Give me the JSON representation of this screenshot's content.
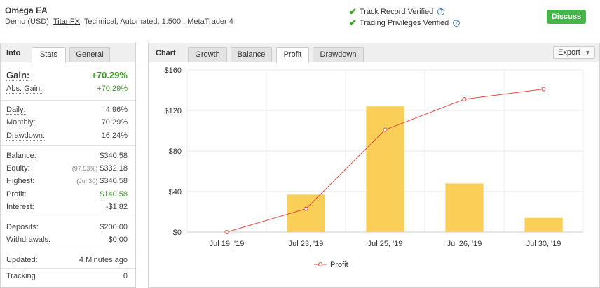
{
  "header": {
    "title": "Omega EA",
    "sub_prefix": "Demo (USD), ",
    "broker_link": "TitanFX",
    "sub_suffix": ", Technical, Automated, 1:500 , MetaTrader 4",
    "verify1": "Track Record Verified",
    "verify2": "Trading Privileges Verified",
    "help_glyph": "?",
    "discuss": "Discuss"
  },
  "info": {
    "tab_title": "Info",
    "tabs": [
      "Stats",
      "General"
    ],
    "gain_label": "Gain:",
    "gain_value": "+70.29%",
    "rows": [
      {
        "k": "Abs. Gain:",
        "v": "+70.29%"
      },
      {
        "k": "Daily:",
        "v": "4.96%"
      },
      {
        "k": "Monthly:",
        "v": "70.29%"
      },
      {
        "k": "Drawdown:",
        "v": "16.24%"
      },
      {
        "k": "Balance:",
        "v": "$340.58"
      },
      {
        "k": "Equity:",
        "pre": "(97.53%)",
        "v": "$332.18"
      },
      {
        "k": "Highest:",
        "pre": "(Jul 30)",
        "v": "$340.58"
      },
      {
        "k": "Profit:",
        "v": "$140.58"
      },
      {
        "k": "Interest:",
        "v": "-$1.82"
      },
      {
        "k": "Deposits:",
        "v": "$200.00"
      },
      {
        "k": "Withdrawals:",
        "v": "$0.00"
      },
      {
        "k": "Updated:",
        "v": "4 Minutes ago"
      },
      {
        "k": "Tracking",
        "v": "0"
      }
    ]
  },
  "chart_panel": {
    "title": "Chart",
    "tabs": [
      "Growth",
      "Balance",
      "Profit",
      "Drawdown"
    ],
    "active_tab": "Profit",
    "export": "Export",
    "caret": "▼"
  },
  "colors": {
    "bar": "#f9cf57",
    "line": "#e34a3d",
    "green": "#45b549"
  },
  "chart_data": {
    "type": "bar",
    "categories": [
      "Jul 19, '19",
      "Jul 23, '19",
      "Jul 25, '19",
      "Jul 26, '19",
      "Jul 30, '19"
    ],
    "series": [
      {
        "type": "bar",
        "values": [
          0,
          37,
          124,
          48,
          14
        ]
      },
      {
        "type": "line",
        "name": "Profit",
        "values": [
          0,
          23,
          101,
          131,
          141
        ]
      }
    ],
    "y_ticks": [
      "$0",
      "$40",
      "$80",
      "$120",
      "$160"
    ],
    "ylim": [
      0,
      160
    ],
    "legend": "Profit"
  }
}
